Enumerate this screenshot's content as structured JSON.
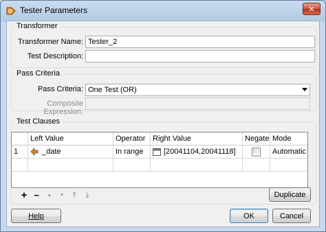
{
  "window": {
    "title": "Tester Parameters",
    "close_glyph": "✕"
  },
  "transformer": {
    "group_title": "Transformer",
    "name_label": "Transformer Name:",
    "name_value": "Tester_2",
    "description_label": "Test Description:",
    "description_value": ""
  },
  "pass_criteria": {
    "group_title": "Pass Criteria",
    "criteria_label": "Pass Criteria:",
    "criteria_value": "One Test (OR)",
    "composite_label": "Composite Expression:",
    "composite_value": ""
  },
  "test_clauses": {
    "group_title": "Test Clauses",
    "columns": [
      "Left Value",
      "Operator",
      "Right Value",
      "Negate",
      "Mode"
    ],
    "rows": [
      {
        "num": "1",
        "left_icon": "attribute-arrow-icon",
        "left_value": "_date",
        "operator": "In range",
        "right_icon": "range-editor-icon",
        "right_value": "[20041104,20041118]",
        "negate": false,
        "mode": "Automatic"
      }
    ],
    "toolbar": {
      "add": "+",
      "remove": "−",
      "move_up": "▲",
      "move_down": "▼",
      "move_top": "⤒",
      "move_bottom": "⤓"
    },
    "duplicate_label": "Duplicate"
  },
  "footer": {
    "help_label": "Help",
    "ok_label": "OK",
    "cancel_label": "Cancel"
  }
}
